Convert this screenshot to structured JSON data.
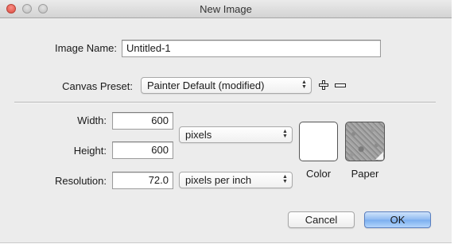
{
  "window": {
    "title": "New Image"
  },
  "image_name": {
    "label": "Image Name:",
    "value": "Untitled-1"
  },
  "canvas_preset": {
    "label": "Canvas Preset:",
    "value": "Painter Default (modified)"
  },
  "width": {
    "label": "Width:",
    "value": "600"
  },
  "height": {
    "label": "Height:",
    "value": "600"
  },
  "resolution": {
    "label": "Resolution:",
    "value": "72.0"
  },
  "size_unit": {
    "value": "pixels"
  },
  "resolution_unit": {
    "value": "pixels per inch"
  },
  "color": {
    "label": "Color",
    "swatch": "#ffffff"
  },
  "paper": {
    "label": "Paper"
  },
  "buttons": {
    "cancel": "Cancel",
    "ok": "OK"
  },
  "icons": {
    "add": "plus-icon",
    "remove": "minus-icon",
    "popup": "up-down-arrows-icon"
  },
  "colors": {
    "default_button": "#8fbaf1",
    "close_button": "#de4a3f",
    "window_bg": "#ececec"
  }
}
